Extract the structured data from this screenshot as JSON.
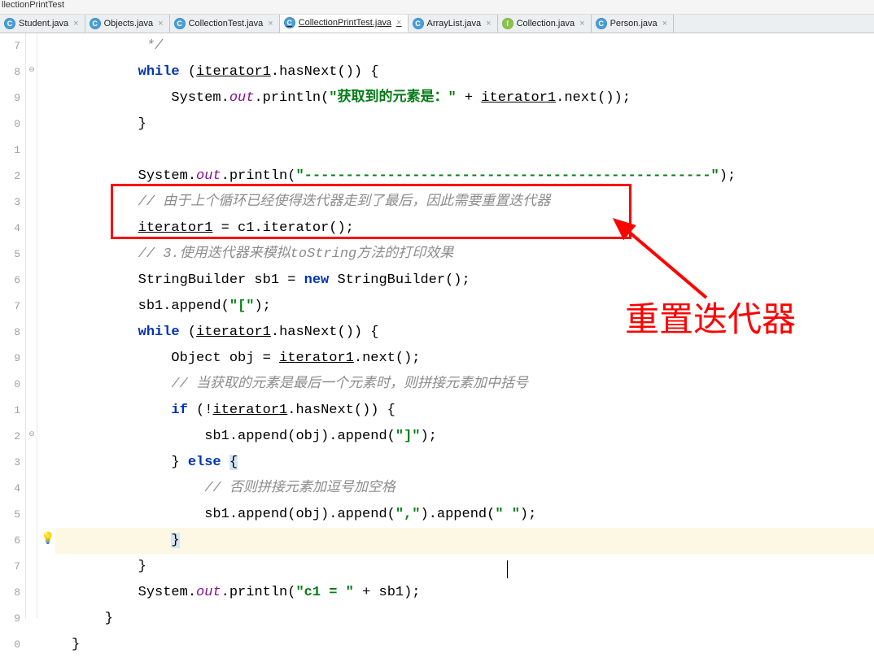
{
  "window": {
    "title": "llectionPrintTest"
  },
  "tabs": [
    {
      "label": "Student.java",
      "icon": "c"
    },
    {
      "label": "Objects.java",
      "icon": "c"
    },
    {
      "label": "CollectionTest.java",
      "icon": "c"
    },
    {
      "label": "CollectionPrintTest.java",
      "icon": "c",
      "active": true
    },
    {
      "label": "ArrayList.java",
      "icon": "c"
    },
    {
      "label": "Collection.java",
      "icon": "i"
    },
    {
      "label": "Person.java",
      "icon": "c"
    }
  ],
  "gutter": [
    "7",
    "8",
    "9",
    "0",
    "1",
    "2",
    "3",
    "4",
    "5",
    "6",
    "7",
    "8",
    "9",
    "0",
    "1",
    "2",
    "3",
    "4",
    "5",
    "6",
    "7",
    "8",
    "9",
    "0"
  ],
  "code": {
    "l7": "         */",
    "l8a": "        ",
    "l8b": "while",
    "l8c": " (",
    "l8d": "iterator1",
    "l8e": ".hasNext()) {",
    "l9a": "            System.",
    "l9b": "out",
    "l9c": ".println(",
    "l9d": "\"获取到的元素是：\"",
    "l9e": " + ",
    "l9f": "iterator1",
    "l9g": ".next());",
    "l10": "        }",
    "l11": "",
    "l12a": "        System.",
    "l12b": "out",
    "l12c": ".println(",
    "l12d": "\"-------------------------------------------------\"",
    "l12e": ");",
    "l13": "        // 由于上个循环已经使得迭代器走到了最后，因此需要重置迭代器",
    "l14a": "        ",
    "l14b": "iterator1",
    "l14c": " = c1.iterator();",
    "l15": "        // 3.使用迭代器来模拟toString方法的打印效果",
    "l16a": "        StringBuilder sb1 = ",
    "l16b": "new",
    "l16c": " StringBuilder();",
    "l17a": "        sb1.append(",
    "l17b": "\"[\"",
    "l17c": ");",
    "l18a": "        ",
    "l18b": "while",
    "l18c": " (",
    "l18d": "iterator1",
    "l18e": ".hasNext()) {",
    "l19a": "            Object obj = ",
    "l19b": "iterator1",
    "l19c": ".next();",
    "l20": "            // 当获取的元素是最后一个元素时，则拼接元素加中括号",
    "l21a": "            ",
    "l21b": "if",
    "l21c": " (!",
    "l21d": "iterator1",
    "l21e": ".hasNext()) {",
    "l22a": "                sb1.append(obj).append(",
    "l22b": "\"]\"",
    "l22c": ");",
    "l23a": "            } ",
    "l23b": "else",
    "l23c": " ",
    "l23d": "{",
    "l24": "                // 否则拼接元素加逗号加空格",
    "l25a": "                sb1.append(obj).append(",
    "l25b": "\",\"",
    "l25c": ").append(",
    "l25d": "\" \"",
    "l25e": ");",
    "l26a": "            ",
    "l26b": "}",
    "l27": "        }",
    "l28a": "        System.",
    "l28b": "out",
    "l28c": ".println(",
    "l28d": "\"c1 = \"",
    "l28e": " + sb1);",
    "l29": "    }",
    "l30": "}"
  },
  "close_x": "×",
  "annotation": "重置迭代器"
}
